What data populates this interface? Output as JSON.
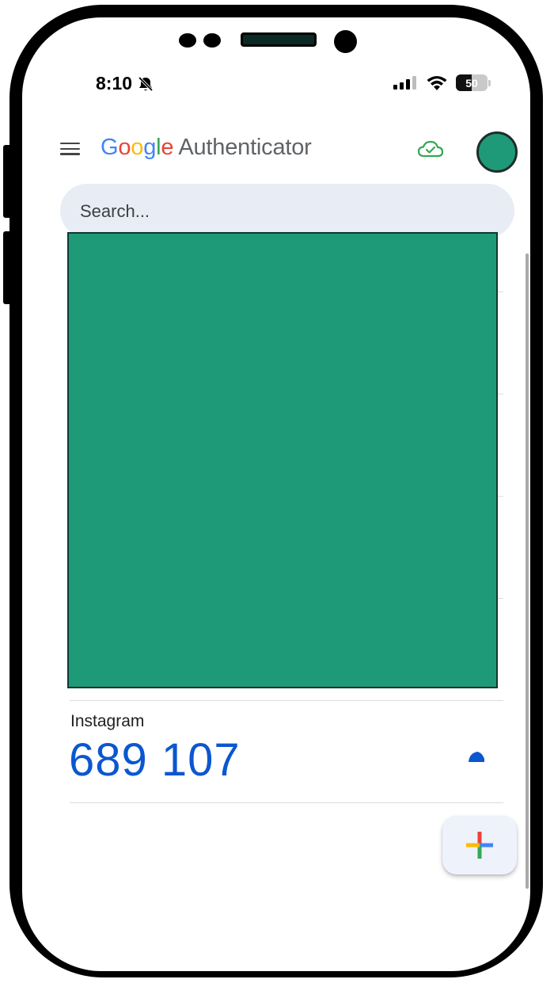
{
  "status_bar": {
    "time": "8:10",
    "battery": "50"
  },
  "header": {
    "logo_letters": [
      "G",
      "o",
      "o",
      "g",
      "l",
      "e"
    ],
    "app_name": "Authenticator"
  },
  "search": {
    "placeholder": "Search..."
  },
  "accounts": [
    {
      "name": "Instagram",
      "code": "689 107"
    }
  ],
  "colors": {
    "accent_blue": "#0b57d0",
    "redaction_green": "#1f9a78",
    "search_bg": "#e8ecf5"
  },
  "icons": {
    "menu": "hamburger-icon",
    "sync": "cloud-check-icon",
    "add": "google-plus-icon",
    "timer": "countdown-timer-icon"
  }
}
